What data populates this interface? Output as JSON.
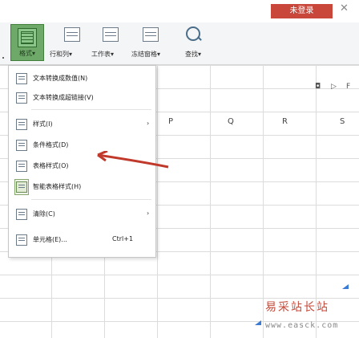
{
  "topbar": {
    "login_label": "未登录",
    "close_glyph": "✕"
  },
  "ribbon": {
    "format_label": "格式▾",
    "buttons": [
      {
        "label": "行和列▾"
      },
      {
        "label": "工作表▾"
      },
      {
        "label": "冻结窗格▾"
      },
      {
        "label": "查找▾"
      }
    ]
  },
  "columns": [
    "P",
    "Q",
    "R",
    "S"
  ],
  "side_icons": [
    "◘",
    "▷",
    "F"
  ],
  "menu": {
    "items": [
      {
        "label": "文本转换成数值(N)",
        "arrow": "",
        "shortcut": ""
      },
      {
        "label": "文本转换成超链接(V)",
        "arrow": "",
        "shortcut": ""
      },
      {
        "label": "样式(I)",
        "arrow": "›",
        "shortcut": ""
      },
      {
        "label": "条件格式(D)",
        "arrow": "",
        "shortcut": ""
      },
      {
        "label": "表格样式(O)",
        "arrow": "",
        "shortcut": ""
      },
      {
        "label": "智能表格样式(H)",
        "arrow": "",
        "shortcut": ""
      },
      {
        "label": "清除(C)",
        "arrow": "›",
        "shortcut": ""
      },
      {
        "label": "单元格(E)...",
        "arrow": "",
        "shortcut": "Ctrl+1"
      }
    ]
  },
  "watermark": {
    "text": "易采站长站",
    "url": "www.easck.com"
  },
  "colors": {
    "accent_red": "#c8463a",
    "highlight_green": "#6fa96a",
    "arrow_red": "#c0392b"
  }
}
